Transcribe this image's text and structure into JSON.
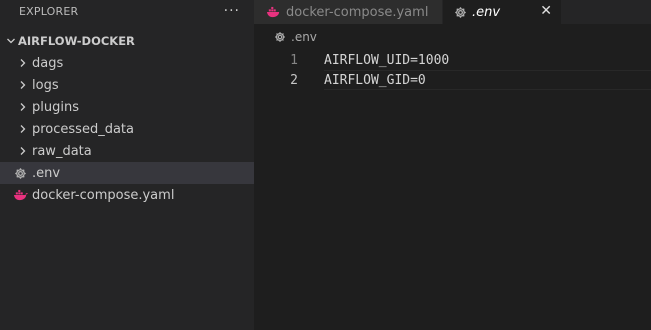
{
  "explorer": {
    "title": "EXPLORER",
    "more_label": "···",
    "folder_name": "AIRFLOW-DOCKER",
    "items": [
      {
        "label": "dags",
        "type": "folder"
      },
      {
        "label": "logs",
        "type": "folder"
      },
      {
        "label": "plugins",
        "type": "folder"
      },
      {
        "label": "processed_data",
        "type": "folder"
      },
      {
        "label": "raw_data",
        "type": "folder"
      },
      {
        "label": ".env",
        "type": "file",
        "icon": "gear-icon",
        "active": true
      },
      {
        "label": "docker-compose.yaml",
        "type": "file",
        "icon": "docker-whale-icon"
      }
    ]
  },
  "tabs": [
    {
      "label": "docker-compose.yaml",
      "icon": "docker-whale-icon",
      "active": false
    },
    {
      "label": ".env",
      "icon": "gear-icon",
      "active": true,
      "close": "✕"
    }
  ],
  "breadcrumb": {
    "label": ".env"
  },
  "editor": {
    "lines": [
      {
        "num": "1",
        "text": "AIRFLOW_UID=1000"
      },
      {
        "num": "2",
        "text": "AIRFLOW_GID=0"
      }
    ]
  },
  "colors": {
    "docker_icon": "#e8327f",
    "active_row": "#37373d",
    "sidebar_bg": "#252526",
    "editor_bg": "#1e1e1e"
  }
}
